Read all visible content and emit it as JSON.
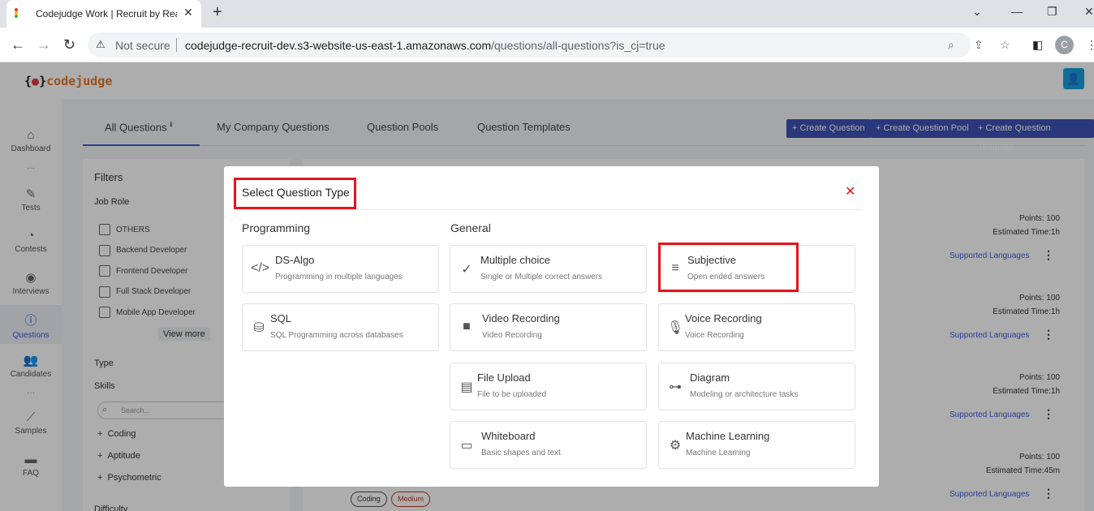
{
  "browser": {
    "tab_title": "Codejudge Work | Recruit by Rea",
    "not_secure": "Not secure",
    "url_host": "codejudge-recruit-dev.s3-website-us-east-1.amazonaws.com",
    "url_path": "/questions/all-questions?is_cj=true",
    "profile_initial": "C"
  },
  "app": {
    "logo_brace_left": "{",
    "logo_brace_right": "}",
    "logo_text": "codejudge",
    "sidebar": [
      {
        "label": "Dashboard",
        "icon": "home-icon"
      },
      {
        "label": "Tests",
        "icon": "pen-icon"
      },
      {
        "label": "Contests",
        "icon": "pie-icon"
      },
      {
        "label": "Interviews",
        "icon": "location-icon"
      },
      {
        "label": "Questions",
        "icon": "question-icon",
        "active": true
      },
      {
        "label": "Candidates",
        "icon": "users-icon"
      },
      {
        "label": "Samples",
        "icon": "chart-icon"
      },
      {
        "label": "FAQ",
        "icon": "chat-icon"
      }
    ],
    "tabs": [
      "All Questions",
      "My Company Questions",
      "Question Pools",
      "Question Templates"
    ],
    "buttons": {
      "create_question": "+ Create Question",
      "create_pool": "+ Create Question Pool",
      "create_template": "+ Create Question Template"
    },
    "filters": {
      "title": "Filters",
      "job_role": "Job Role",
      "roles": [
        "OTHERS",
        "Backend Developer",
        "Frontend Developer",
        "Full Stack Developer",
        "Mobile App Developer"
      ],
      "view_more": "View more",
      "type": "Type",
      "skills": "Skills",
      "search_placeholder": "Search...",
      "skill_items": [
        "Coding",
        "Aptitude",
        "Psychometric"
      ],
      "difficulty": "Difficulty"
    },
    "questions": [
      {
        "points": "Points: 100",
        "time": "Estimated Time:1h",
        "link": "Supported Languages"
      },
      {
        "points": "Points: 100",
        "time": "Estimated Time:1h",
        "link": "Supported Languages"
      },
      {
        "points": "Points: 100",
        "time": "Estimated Time:1h",
        "link": "Supported Languages"
      },
      {
        "points": "Points: 100",
        "time": "Estimated Time:45m",
        "link": "Supported Languages"
      }
    ],
    "tags": [
      "Coding",
      "Medium"
    ]
  },
  "modal": {
    "title": "Select Question Type",
    "programming_heading": "Programming",
    "general_heading": "General",
    "programming": [
      {
        "name": "DS-Algo",
        "desc": "Programming in multiple languages",
        "icon": "code-icon"
      },
      {
        "name": "SQL",
        "desc": "SQL Programming across databases",
        "icon": "database-icon"
      }
    ],
    "general": [
      {
        "name": "Multiple choice",
        "desc": "Single or Multiple correct answers",
        "icon": "check-circle-icon"
      },
      {
        "name": "Subjective",
        "desc": "Open ended answers",
        "icon": "lines-icon"
      },
      {
        "name": "Video Recording",
        "desc": "Video Recording",
        "icon": "video-icon"
      },
      {
        "name": "Voice Recording",
        "desc": "Voice Recording",
        "icon": "mic-icon"
      },
      {
        "name": "File Upload",
        "desc": "File to be uploaded",
        "icon": "file-icon"
      },
      {
        "name": "Diagram",
        "desc": "Modeling or architecture tasks",
        "icon": "diagram-icon"
      },
      {
        "name": "Whiteboard",
        "desc": "Basic shapes and text",
        "icon": "whiteboard-icon"
      },
      {
        "name": "Machine Learning",
        "desc": "Machine Learning",
        "icon": "gear-icon"
      }
    ]
  }
}
